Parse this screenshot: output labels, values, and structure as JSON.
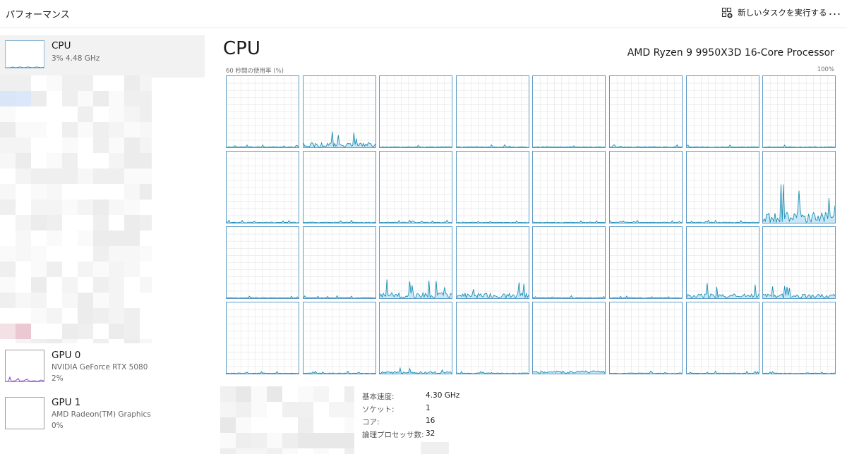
{
  "header": {
    "title": "パフォーマンス",
    "run_task_label": "新しいタスクを実行する",
    "more_label": "..."
  },
  "sidebar": {
    "items": [
      {
        "name": "CPU",
        "subtitle": "3%  4.48 GHz",
        "usage_percent": 3
      },
      {
        "name": "GPU 0",
        "subtitle": "NVIDIA GeForce RTX 5080",
        "subtitle2": "2%",
        "usage_percent": 2
      },
      {
        "name": "GPU 1",
        "subtitle": "AMD Radeon(TM) Graphics",
        "subtitle2": "0%",
        "usage_percent": 0
      }
    ]
  },
  "main": {
    "title": "CPU",
    "processor": "AMD Ryzen 9 9950X3D 16-Core Processor",
    "axis_left": "60 秒間の使用率 (%)",
    "axis_right": "100%",
    "logical_processor_count": 32
  },
  "stats": [
    {
      "label": "基本速度:",
      "value": "4.30 GHz"
    },
    {
      "label": "ソケット:",
      "value": "1"
    },
    {
      "label": "コア:",
      "value": "16"
    },
    {
      "label": "論理プロセッサ数:",
      "value": "32"
    }
  ],
  "colors": {
    "accent_line": "#1a8fb5",
    "accent_fill": "#c8e6f5",
    "graph_border": "#5d9ac7",
    "gpu_line": "#8b3fc4",
    "grid": "#e4e4e4"
  }
}
